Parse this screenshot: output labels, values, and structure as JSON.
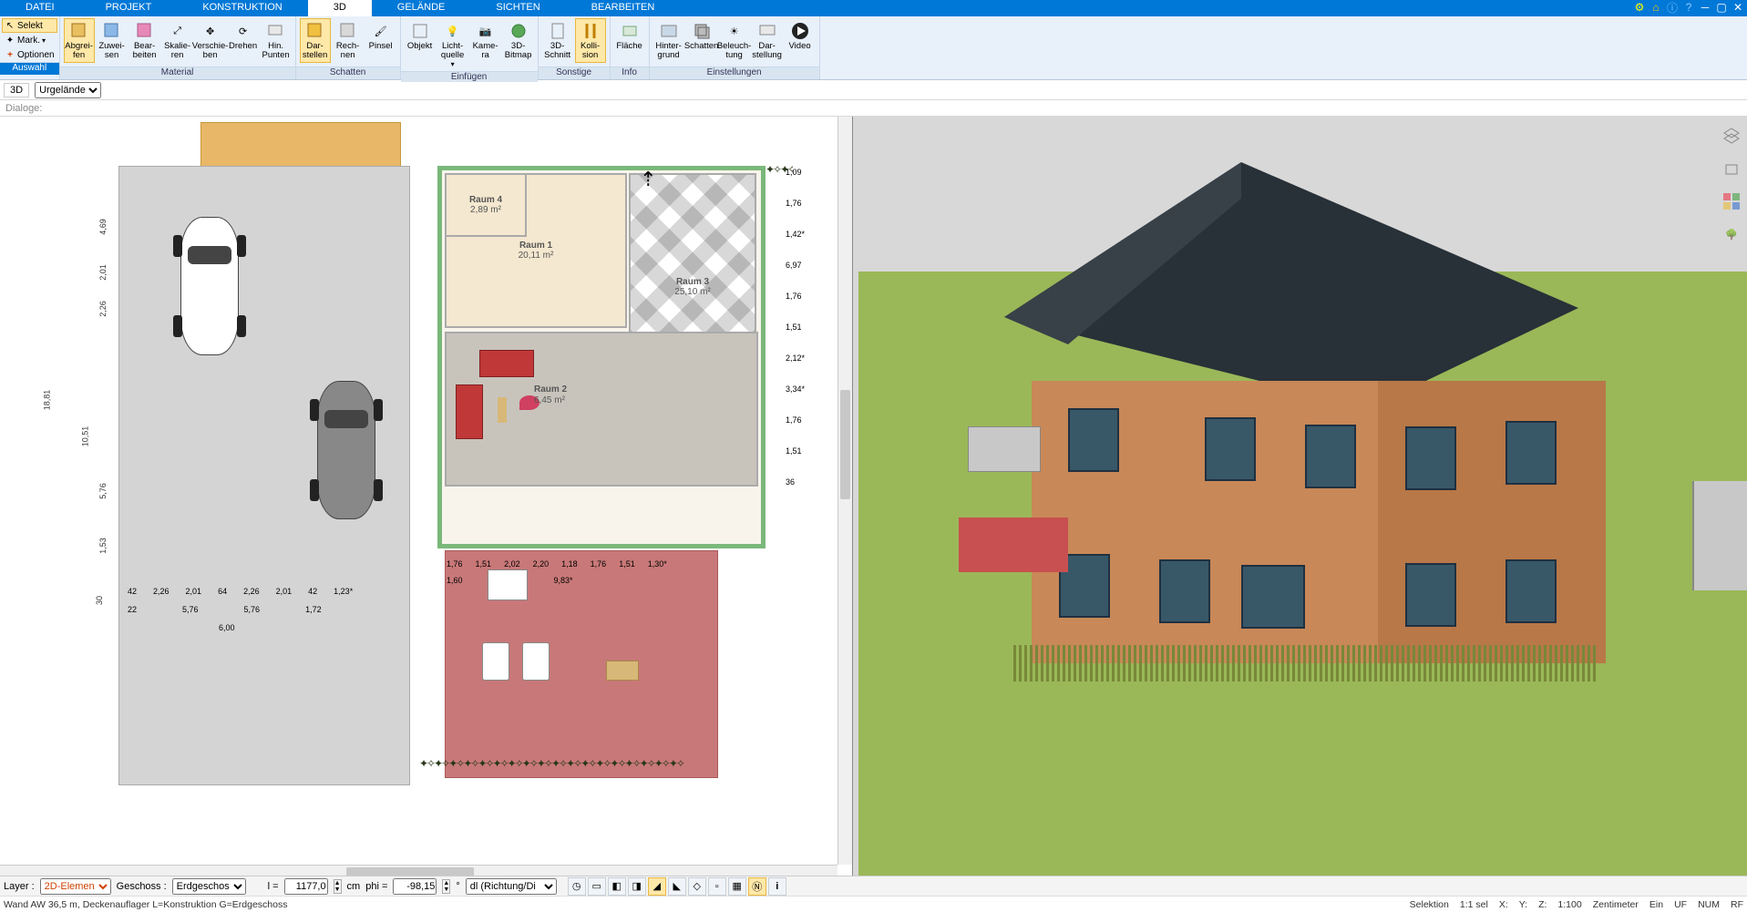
{
  "menubar": {
    "tabs": [
      "DATEI",
      "PROJEKT",
      "KONSTRUKTION",
      "3D",
      "GELÄNDE",
      "SICHTEN",
      "BEARBEITEN"
    ],
    "active": "3D"
  },
  "ribbon": {
    "auswahl": {
      "title": "Auswahl",
      "selekt": "Selekt",
      "mark": "Mark.",
      "optionen": "Optionen"
    },
    "material": {
      "title": "Material",
      "abgreifen": "Abgrei-\nfen",
      "zuweisen": "Zuwei-\nsen",
      "bearbeiten": "Bear-\nbeiten",
      "skalieren": "Skalie-\nren",
      "verschieben": "Verschie-\nben",
      "drehen": "Drehen",
      "hinpunten": "Hin.\nPunten"
    },
    "schatten": {
      "title": "Schatten",
      "darstellen": "Dar-\nstellen",
      "rechnen": "Rech-\nnen",
      "pinsel": "Pinsel"
    },
    "einfuegen": {
      "title": "Einfügen",
      "objekt": "Objekt",
      "lichtquelle": "Licht-\nquelle",
      "kamera": "Kame-\nra",
      "bitmap": "3D-\nBitmap"
    },
    "sonstige": {
      "title": "Sonstige",
      "schnitt": "3D-\nSchnitt",
      "kollision": "Kolli-\nsion"
    },
    "info": {
      "title": "Info",
      "flaeche": "Fläche"
    },
    "einstellungen": {
      "title": "Einstellungen",
      "hintergrund": "Hinter-\ngrund",
      "schatten2": "Schatten",
      "beleuchtung": "Beleuch-\ntung",
      "darstellung": "Dar-\nstellung",
      "video": "Video"
    }
  },
  "subbar": {
    "view": "3D",
    "terrain": "Urgelände"
  },
  "dialogs_label": "Dialoge:",
  "plan": {
    "rooms": {
      "r1": {
        "name": "Raum 1",
        "area": "20,11 m²"
      },
      "r2": {
        "name": "Raum 2",
        "area": "6,45 m²"
      },
      "r3": {
        "name": "Raum 3",
        "area": "25,10 m²"
      },
      "r4": {
        "name": "Raum 4",
        "area": "2,89 m²"
      }
    },
    "dims_left": [
      "18,81",
      "4,69",
      "2,01",
      "2,26",
      "10,51",
      "5,76",
      "1,53",
      "30"
    ],
    "dims_bottom_drive": [
      "42",
      "2,26",
      "2,01",
      "64",
      "2,26",
      "2,01",
      "42",
      "1,23*"
    ],
    "dims_bottom_drive2": [
      "22",
      "5,76",
      "5,76",
      "1,72"
    ],
    "dims_bottom_drive3": [
      "6,00"
    ],
    "dims_house_bottom": [
      "1,76",
      "1,51",
      "2,02",
      "2,20",
      "1,18",
      "1,76",
      "1,51",
      "1,30*"
    ],
    "dims_house_bottom2": [
      "1,60",
      "9,83*"
    ],
    "dims_right": [
      "1,09",
      "1,76",
      "1,42*",
      "6,97",
      "1,76",
      "1,51",
      "2,12*",
      "3,34*",
      "1,76",
      "1,51",
      "36"
    ]
  },
  "bottombar": {
    "layer_label": "Layer :",
    "layer_value": "2D-Elemen",
    "geschoss_label": "Geschoss :",
    "geschoss_value": "Erdgeschos",
    "l_label": "l =",
    "l_value": "1177,0",
    "cm_label": "cm",
    "phi_label": "phi =",
    "phi_value": "-98,15",
    "deg_label": "°",
    "dl_value": "dl (Richtung/Di"
  },
  "status": {
    "left": "Wand AW 36,5 m, Deckenauflager L=Konstruktion G=Erdgeschoss",
    "selektion": "Selektion",
    "ratio": "1:1 sel",
    "x": "X:",
    "y": "Y:",
    "z": "Z:",
    "scale": "1:100",
    "unit": "Zentimeter",
    "ein": "Ein",
    "uf": "UF",
    "num": "NUM",
    "rf": "RF"
  }
}
